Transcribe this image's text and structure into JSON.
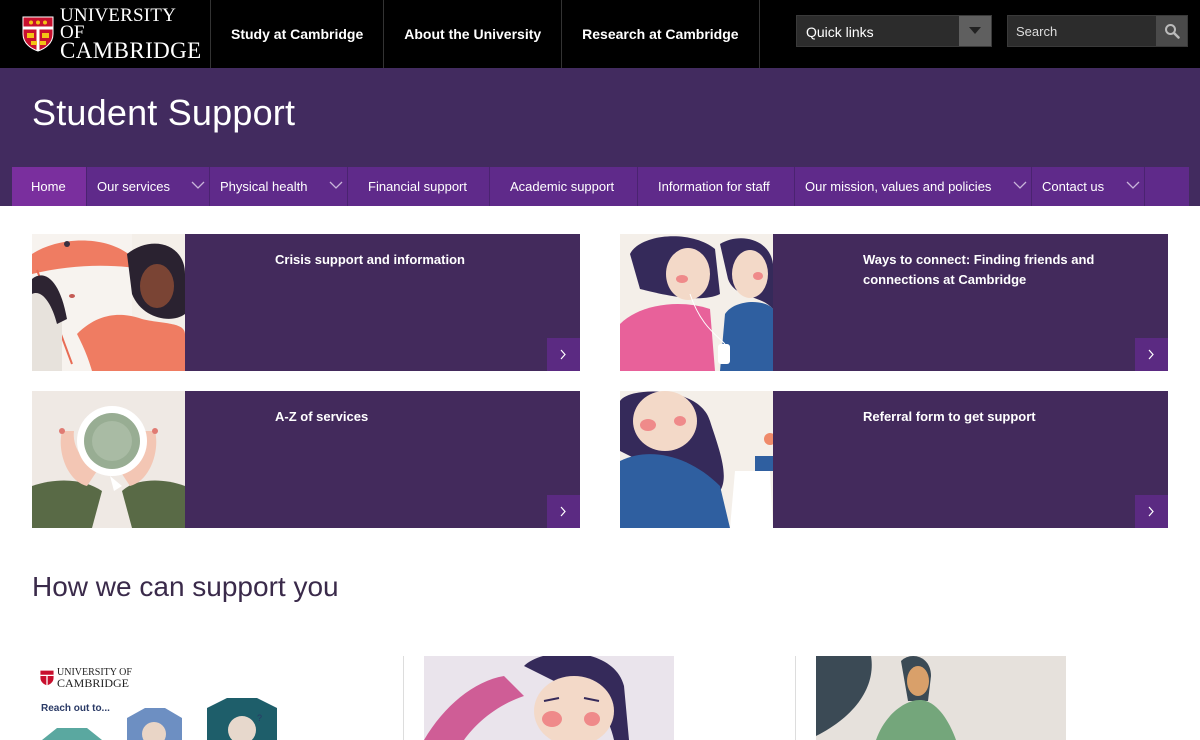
{
  "header": {
    "logo": {
      "line1": "UNIVERSITY OF",
      "line2": "CAMBRIDGE"
    },
    "nav": [
      "Study at Cambridge",
      "About the University",
      "Research at Cambridge"
    ],
    "quick_links": {
      "label": "Quick links"
    },
    "search": {
      "placeholder": "Search"
    }
  },
  "site": {
    "title": "Student Support",
    "subnav": [
      {
        "label": "Home",
        "active": true,
        "dropdown": false
      },
      {
        "label": "Our services",
        "active": false,
        "dropdown": true
      },
      {
        "label": "Physical health",
        "active": false,
        "dropdown": true
      },
      {
        "label": "Financial support",
        "active": false,
        "dropdown": false
      },
      {
        "label": "Academic support",
        "active": false,
        "dropdown": false
      },
      {
        "label": "Information for staff",
        "active": false,
        "dropdown": false
      },
      {
        "label": "Our mission, values and policies",
        "active": false,
        "dropdown": true
      },
      {
        "label": "Contact us",
        "active": false,
        "dropdown": true
      }
    ]
  },
  "cards": [
    {
      "title": "Crisis support and information"
    },
    {
      "title": "Ways to connect: Finding friends and connections at Cambridge"
    },
    {
      "title": "A-Z of services"
    },
    {
      "title": "Referral form to get support"
    }
  ],
  "section": {
    "title": "How we can support you",
    "promo": {
      "logo_line1": "UNIVERSITY OF",
      "logo_line2": "CAMBRIDGE",
      "text": "Reach out to..."
    }
  },
  "colors": {
    "topbar": "#000000",
    "header_purple": "#422b5f",
    "subnav_purple": "#5f2a8a",
    "active_tab": "#7a2f9e",
    "card_purple": "#432a5c",
    "card_arrow": "#5b2a82"
  }
}
